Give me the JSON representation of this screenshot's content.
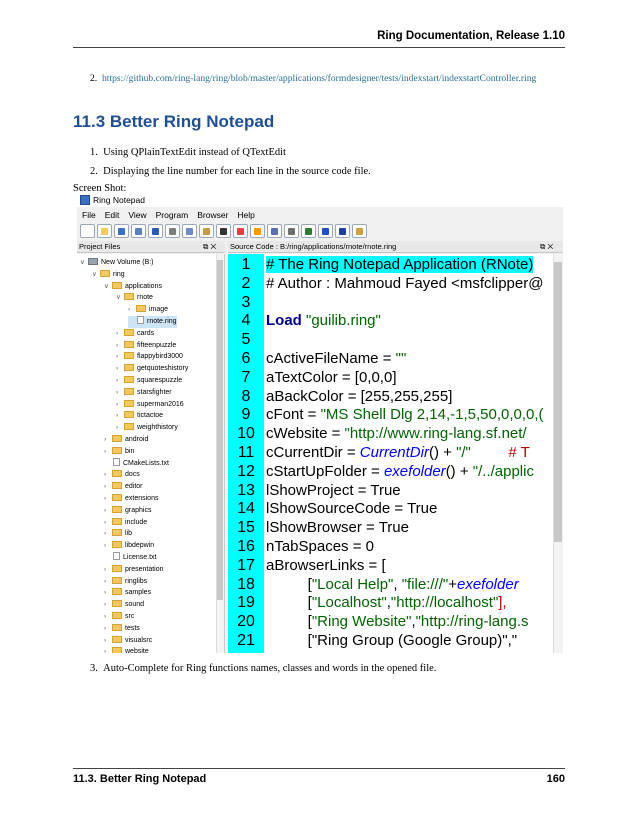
{
  "header": {
    "title": "Ring Documentation, Release 1.10"
  },
  "url_item": {
    "number": "2.",
    "link": "https://github.com/ring-lang/ring/blob/master/applications/formdesigner/tests/indexstart/indexstartController.ring"
  },
  "section": {
    "title": "11.3  Better Ring Notepad"
  },
  "features": [
    {
      "number": "1.",
      "text": "Using QPlainTextEdit instead of QTextEdit"
    },
    {
      "number": "2.",
      "text": "Displaying the line number for each line in the source code file."
    },
    {
      "number": "3.",
      "text": "Auto-Complete for Ring functions names, classes and words in the opened file."
    }
  ],
  "caption": "Screen Shot:",
  "app": {
    "title": "Ring Notepad",
    "menus": [
      "File",
      "Edit",
      "View",
      "Program",
      "Browser",
      "Help"
    ],
    "toolbar_icons": [
      {
        "name": "new-file-icon",
        "color": "#ffffff"
      },
      {
        "name": "open-icon",
        "color": "#f3c85c"
      },
      {
        "name": "save-icon",
        "color": "#3a6fc4"
      },
      {
        "name": "save-as-icon",
        "color": "#5b7fc0"
      },
      {
        "name": "undo-icon",
        "color": "#2b5bb5"
      },
      {
        "name": "cut-icon",
        "color": "#7d7d7d"
      },
      {
        "name": "copy-icon",
        "color": "#6c8bc9"
      },
      {
        "name": "paste-icon",
        "color": "#c79a4a"
      },
      {
        "name": "font-icon",
        "color": "#333333"
      },
      {
        "name": "color-icon",
        "color": "#e04040"
      },
      {
        "name": "background-color-icon",
        "color": "#ff9a00"
      },
      {
        "name": "search-icon",
        "color": "#5a6fb0"
      },
      {
        "name": "print-icon",
        "color": "#6d6d6d"
      },
      {
        "name": "debug-icon",
        "color": "#2f7a2f"
      },
      {
        "name": "run-icon",
        "color": "#2050c8"
      },
      {
        "name": "run-gui-icon",
        "color": "#1e3f9a"
      },
      {
        "name": "close-icon",
        "color": "#d0a040"
      }
    ],
    "project_files_title": "Project Files",
    "source_title": "Source Code : B:/ring/applications/rnote/rnote.ring",
    "panel_controls": "⧉ ✕",
    "tree": [
      {
        "label": "New Volume (B:)",
        "indent": 0,
        "type": "drive",
        "arrow": "∨"
      },
      {
        "label": "ring",
        "indent": 1,
        "type": "folder",
        "arrow": "∨"
      },
      {
        "label": "applications",
        "indent": 2,
        "type": "folder",
        "arrow": "∨"
      },
      {
        "label": "rnote",
        "indent": 3,
        "type": "folder",
        "arrow": "∨"
      },
      {
        "label": "image",
        "indent": 4,
        "type": "folder",
        "arrow": "›"
      },
      {
        "label": "rnote.ring",
        "indent": 4,
        "type": "file",
        "arrow": "",
        "selected": true
      },
      {
        "label": "cards",
        "indent": 3,
        "type": "folder",
        "arrow": "›"
      },
      {
        "label": "fifteenpuzzle",
        "indent": 3,
        "type": "folder",
        "arrow": "›"
      },
      {
        "label": "flappybird3000",
        "indent": 3,
        "type": "folder",
        "arrow": "›"
      },
      {
        "label": "getquoteshistory",
        "indent": 3,
        "type": "folder",
        "arrow": "›"
      },
      {
        "label": "squarespuzzle",
        "indent": 3,
        "type": "folder",
        "arrow": "›"
      },
      {
        "label": "starsfighter",
        "indent": 3,
        "type": "folder",
        "arrow": "›"
      },
      {
        "label": "superman2016",
        "indent": 3,
        "type": "folder",
        "arrow": "›"
      },
      {
        "label": "tictactoe",
        "indent": 3,
        "type": "folder",
        "arrow": "›"
      },
      {
        "label": "weighthistory",
        "indent": 3,
        "type": "folder",
        "arrow": "›"
      },
      {
        "label": "android",
        "indent": 2,
        "type": "folder",
        "arrow": "›"
      },
      {
        "label": "bin",
        "indent": 2,
        "type": "folder",
        "arrow": "›"
      },
      {
        "label": "CMakeLists.txt",
        "indent": 2,
        "type": "file",
        "arrow": ""
      },
      {
        "label": "docs",
        "indent": 2,
        "type": "folder",
        "arrow": "›"
      },
      {
        "label": "editor",
        "indent": 2,
        "type": "folder",
        "arrow": "›"
      },
      {
        "label": "extensions",
        "indent": 2,
        "type": "folder",
        "arrow": "›"
      },
      {
        "label": "graphics",
        "indent": 2,
        "type": "folder",
        "arrow": "›"
      },
      {
        "label": "include",
        "indent": 2,
        "type": "folder",
        "arrow": "›"
      },
      {
        "label": "lib",
        "indent": 2,
        "type": "folder",
        "arrow": "›"
      },
      {
        "label": "libdepwin",
        "indent": 2,
        "type": "folder",
        "arrow": "›"
      },
      {
        "label": "License.txt",
        "indent": 2,
        "type": "file",
        "arrow": ""
      },
      {
        "label": "presentation",
        "indent": 2,
        "type": "folder",
        "arrow": "›"
      },
      {
        "label": "ringlibs",
        "indent": 2,
        "type": "folder",
        "arrow": "›"
      },
      {
        "label": "samples",
        "indent": 2,
        "type": "folder",
        "arrow": "›"
      },
      {
        "label": "sound",
        "indent": 2,
        "type": "folder",
        "arrow": "›"
      },
      {
        "label": "src",
        "indent": 2,
        "type": "folder",
        "arrow": "›"
      },
      {
        "label": "tests",
        "indent": 2,
        "type": "folder",
        "arrow": "›"
      },
      {
        "label": "visualsrc",
        "indent": 2,
        "type": "folder",
        "arrow": "›"
      },
      {
        "label": "website",
        "indent": 2,
        "type": "folder",
        "arrow": "›"
      }
    ],
    "code_lines": [
      [
        {
          "t": "# The Ring Notepad Application (RNote)",
          "c": "comment hl1"
        }
      ],
      [
        {
          "t": "# Author : Mahmoud Fayed <msfclipper@",
          "c": "comment"
        }
      ],
      [
        {
          "t": "",
          "c": ""
        }
      ],
      [
        {
          "t": "Load ",
          "c": "kw"
        },
        {
          "t": "\"guilib.ring\"",
          "c": "str"
        }
      ],
      [
        {
          "t": "",
          "c": ""
        }
      ],
      [
        {
          "t": "cActiveFileName = ",
          "c": ""
        },
        {
          "t": "\"\"",
          "c": "str"
        }
      ],
      [
        {
          "t": "aTextColor = [0,0,0]",
          "c": ""
        }
      ],
      [
        {
          "t": "aBackColor = [255,255,255]",
          "c": ""
        }
      ],
      [
        {
          "t": "cFont = ",
          "c": ""
        },
        {
          "t": "\"MS Shell Dlg 2,14,-1,5,50,0,0,0,(",
          "c": "str"
        }
      ],
      [
        {
          "t": "cWebsite = ",
          "c": ""
        },
        {
          "t": "\"http://www.ring-lang.sf.net/",
          "c": "str"
        }
      ],
      [
        {
          "t": "cCurrentDir = ",
          "c": ""
        },
        {
          "t": "CurrentDir",
          "c": "fn"
        },
        {
          "t": "() + ",
          "c": ""
        },
        {
          "t": "\"/\"",
          "c": "str"
        },
        {
          "t": "         # T",
          "c": "red"
        }
      ],
      [
        {
          "t": "cStartUpFolder = ",
          "c": ""
        },
        {
          "t": "exefolder",
          "c": "fn"
        },
        {
          "t": "() + ",
          "c": ""
        },
        {
          "t": "\"/../applic",
          "c": "str"
        }
      ],
      [
        {
          "t": "lShowProject = True",
          "c": ""
        }
      ],
      [
        {
          "t": "lShowSourceCode = True",
          "c": ""
        }
      ],
      [
        {
          "t": "lShowBrowser = True",
          "c": ""
        }
      ],
      [
        {
          "t": "nTabSpaces = 0",
          "c": ""
        }
      ],
      [
        {
          "t": "aBrowserLinks = [",
          "c": ""
        }
      ],
      [
        {
          "t": "          [",
          "c": ""
        },
        {
          "t": "\"Local Help\"",
          "c": "str"
        },
        {
          "t": ", ",
          "c": ""
        },
        {
          "t": "\"file:///\"",
          "c": "str"
        },
        {
          "t": "+",
          "c": ""
        },
        {
          "t": "exefolder",
          "c": "fn"
        }
      ],
      [
        {
          "t": "          [",
          "c": ""
        },
        {
          "t": "\"Localhost\"",
          "c": "str"
        },
        {
          "t": ",",
          "c": ""
        },
        {
          "t": "\"http://localhost\"",
          "c": "str"
        },
        {
          "t": "],",
          "c": "red"
        }
      ],
      [
        {
          "t": "          [",
          "c": ""
        },
        {
          "t": "\"Ring Website\"",
          "c": "str"
        },
        {
          "t": ",",
          "c": ""
        },
        {
          "t": "\"http://ring-lang.s",
          "c": "str"
        }
      ],
      [
        {
          "t": "          [\"Ring Group (Google Group)\",\"",
          "c": ""
        }
      ]
    ]
  },
  "footer": {
    "section": "11.3.  Better Ring Notepad",
    "page": "160"
  }
}
